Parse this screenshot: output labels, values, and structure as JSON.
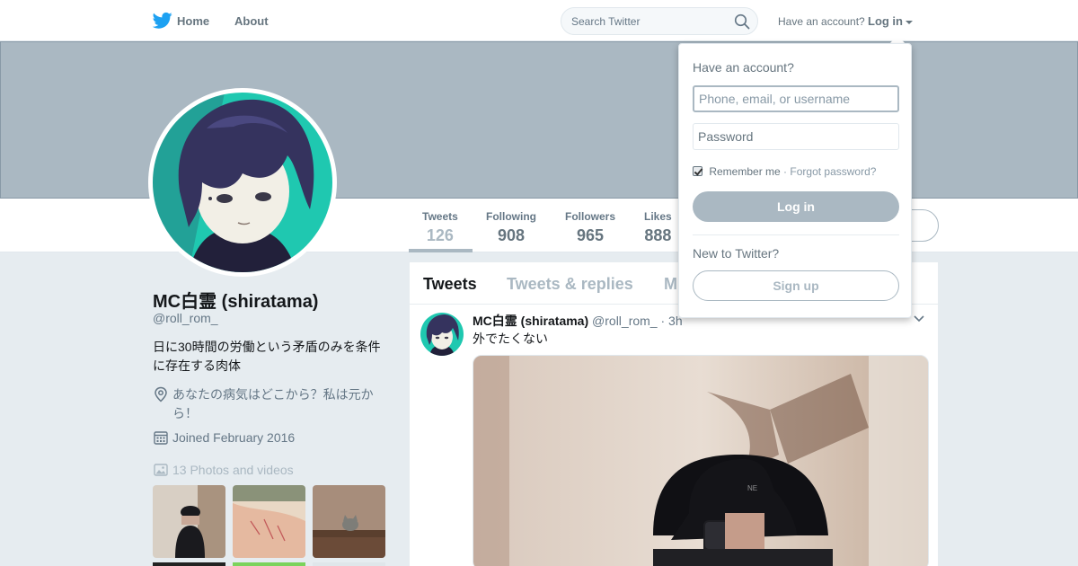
{
  "nav": {
    "home_label": "Home",
    "about_label": "About",
    "search_placeholder": "Search Twitter",
    "account_prompt": "Have an account?",
    "login_label": "Log in"
  },
  "profile": {
    "name": "MC白霊 (shiratama)",
    "handle": "@roll_rom_",
    "bio": "日に30時間の労働という矛盾のみを条件に存在する肉体",
    "location": "あなたの病気はどこから？私は元から！",
    "joined": "Joined February 2016",
    "photos_label": "13 Photos and videos"
  },
  "stats": [
    {
      "label": "Tweets",
      "value": "126"
    },
    {
      "label": "Following",
      "value": "908"
    },
    {
      "label": "Followers",
      "value": "965"
    },
    {
      "label": "Likes",
      "value": "888"
    }
  ],
  "timeline": {
    "tabs": [
      "Tweets",
      "Tweets & replies",
      "M"
    ],
    "tweet": {
      "name": "MC白霊 (shiratama)",
      "handle": "@roll_rom_",
      "time": "· 3h",
      "text": "外でたくない"
    }
  },
  "login_dropdown": {
    "heading": "Have an account?",
    "username_placeholder": "Phone, email, or username",
    "password_placeholder": "Password",
    "remember_label": "Remember me",
    "separator": "·",
    "forgot_label": "Forgot password?",
    "login_button": "Log in",
    "new_prompt": "New to Twitter?",
    "signup_button": "Sign up"
  },
  "colors": {
    "brand_blue": "#1da1f2",
    "banner": "#aab8c2",
    "avatar_accent": "#1fc8b0"
  }
}
